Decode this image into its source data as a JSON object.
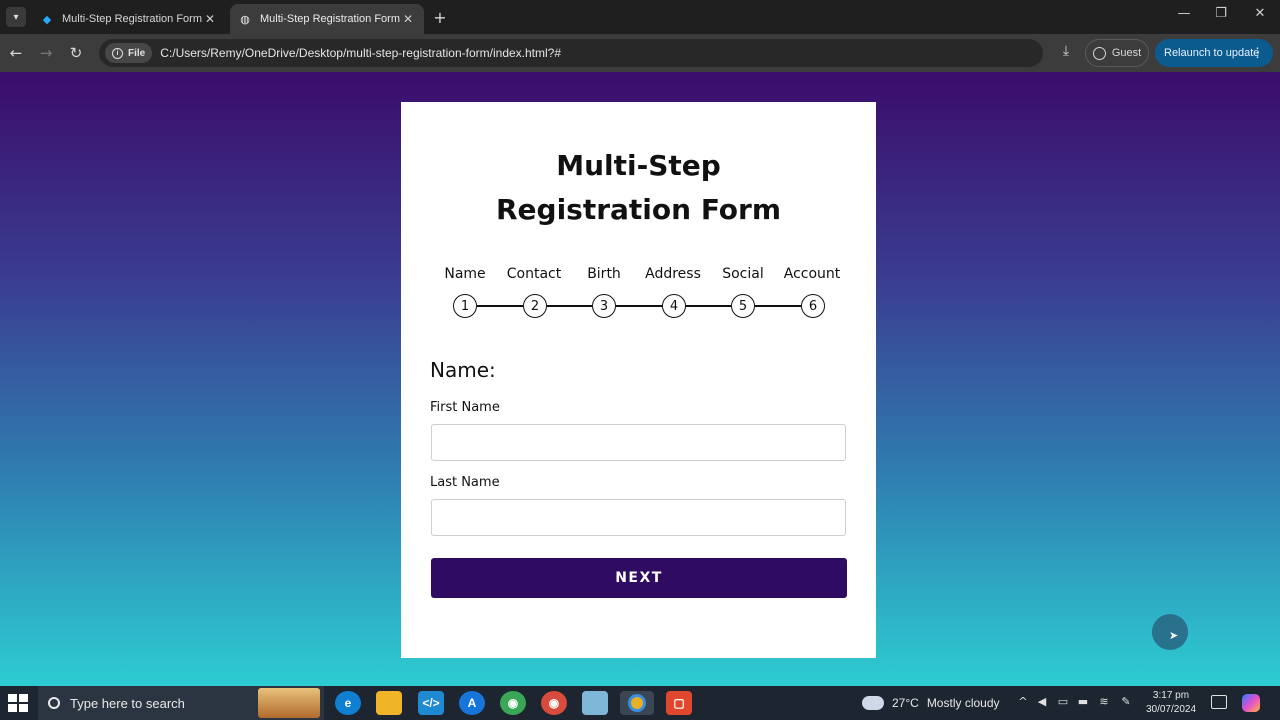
{
  "browser": {
    "tabs": [
      {
        "title": "Multi-Step Registration Form U",
        "active": false,
        "favicon": "drupal-icon"
      },
      {
        "title": "Multi-Step Registration Form",
        "active": true,
        "favicon": "globe-icon"
      }
    ],
    "new_tab_icon": "+",
    "address": {
      "chip_label": "File",
      "url": "C:/Users/Remy/OneDrive/Desktop/multi-step-registration-form/index.html?#"
    },
    "profile_label": "Guest",
    "relaunch_label": "Relaunch to update"
  },
  "form": {
    "title_line1": "Multi-Step",
    "title_line2": "Registration Form",
    "steps": [
      {
        "label": "Name",
        "number": "1"
      },
      {
        "label": "Contact",
        "number": "2"
      },
      {
        "label": "Birth",
        "number": "3"
      },
      {
        "label": "Address",
        "number": "4"
      },
      {
        "label": "Social",
        "number": "5"
      },
      {
        "label": "Account",
        "number": "6"
      }
    ],
    "section_title": "Name:",
    "fields": [
      {
        "label": "First Name",
        "value": "",
        "placeholder": ""
      },
      {
        "label": "Last Name",
        "value": "",
        "placeholder": ""
      }
    ],
    "next_label": "NEXT"
  },
  "colors": {
    "gradient_top": "#3b0c6b",
    "gradient_bottom": "#2dccd2",
    "button_bg": "#2f0c62",
    "relaunch_bg": "#0b5b8f"
  },
  "taskbar": {
    "search_placeholder": "Type here to search",
    "weather": {
      "temp": "27°C",
      "condition": "Mostly cloudy"
    },
    "time": "3:17 pm",
    "date": "30/07/2024",
    "apps": [
      "edge-icon",
      "file-explorer-icon",
      "vscode-icon",
      "app-store-icon",
      "chrome-icon",
      "chrome-icon",
      "notes-icon",
      "chrome-icon",
      "screen-recorder-icon"
    ]
  }
}
